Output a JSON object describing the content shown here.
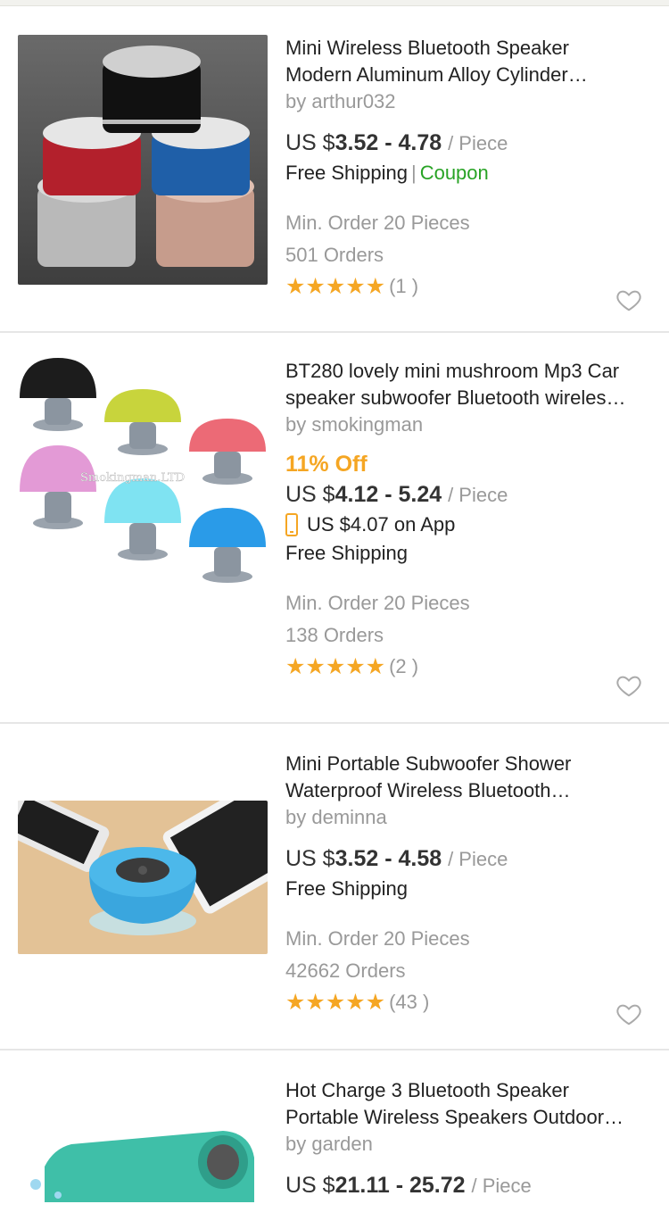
{
  "products": [
    {
      "title_line1": "Mini Wireless Bluetooth Speaker",
      "title_line2": "Modern Aluminum Alloy Cylinder…",
      "seller": "by arthur032",
      "price_prefix": "US $",
      "price_range": "3.52 - 4.78",
      "unit": "/ Piece",
      "shipping": "Free Shipping",
      "separator": "|",
      "coupon": "Coupon",
      "min_order": "Min. Order 20 Pieces",
      "orders": "501 Orders",
      "stars": "★★★★★",
      "reviews": "(1 )",
      "rating": 5
    },
    {
      "title_line1": "BT280 lovely mini mushroom Mp3 Car",
      "title_line2": "speaker subwoofer Bluetooth wireles…",
      "seller": "by smokingman",
      "discount": "11% Off",
      "price_prefix": "US $",
      "price_range": "4.12 - 5.24",
      "unit": "/ Piece",
      "app_price": "US $4.07 on App",
      "shipping": "Free Shipping",
      "min_order": "Min. Order 20 Pieces",
      "orders": "138 Orders",
      "stars": "★★★★★",
      "reviews": "(2 )",
      "rating": 5,
      "image_watermark": "Smokingman.LTD"
    },
    {
      "title_line1": "Mini Portable Subwoofer Shower",
      "title_line2": "Waterproof Wireless Bluetooth…",
      "seller": "by deminna",
      "price_prefix": "US $",
      "price_range": "3.52 - 4.58",
      "unit": "/ Piece",
      "shipping": "Free Shipping",
      "min_order": "Min. Order 20 Pieces",
      "orders": "42662 Orders",
      "stars": "★★★★★",
      "reviews": "(43 )",
      "rating": 5
    },
    {
      "title_line1": "Hot Charge 3 Bluetooth Speaker",
      "title_line2": "Portable Wireless Speakers Outdoor…",
      "seller": "by garden",
      "price_prefix": "US $",
      "price_range": "21.11 - 25.72",
      "unit": "/ Piece"
    }
  ],
  "colors": {
    "star": "#f5a623",
    "discount": "#f5a623",
    "coupon": "#28a325",
    "muted": "#999999"
  }
}
